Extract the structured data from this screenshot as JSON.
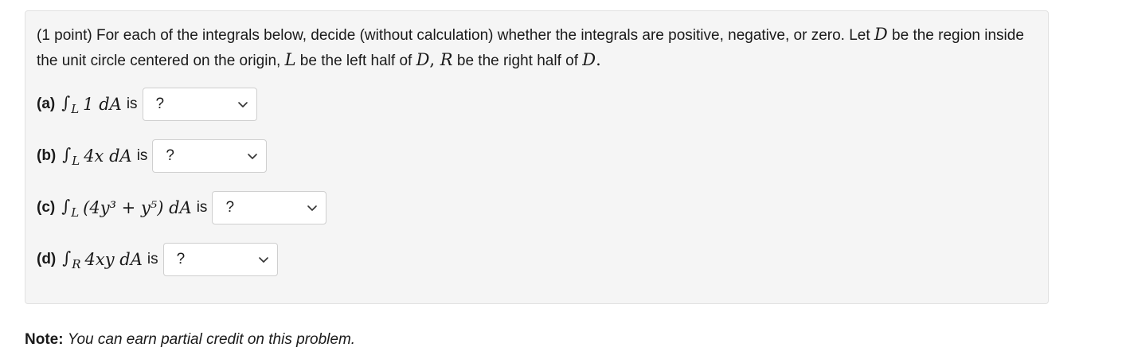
{
  "intro": {
    "prefix": "(1 point) For each of the integrals below, decide (without calculation) whether the integrals are positive, negative, or zero. Let ",
    "D": "D",
    "mid1": " be the region inside the unit circle centered on the origin, ",
    "L": "L",
    "mid2": " be the left half of ",
    "D2": "D",
    "comma": ", ",
    "R": "R",
    "mid3": " be the right half of ",
    "D3": "D",
    "end": "."
  },
  "parts": [
    {
      "label": "(a)",
      "region": "L",
      "expr": "1 dA",
      "is": "is",
      "selected": "?"
    },
    {
      "label": "(b)",
      "region": "L",
      "expr": "4x dA",
      "is": "is",
      "selected": "?"
    },
    {
      "label": "(c)",
      "region": "L",
      "expr": "(4y³ + y⁵) dA",
      "is": "is",
      "selected": "?"
    },
    {
      "label": "(d)",
      "region": "R",
      "expr": "4xy dA",
      "is": "is",
      "selected": "?"
    }
  ],
  "note": {
    "label": "Note:",
    "text": "You can earn partial credit on this problem."
  },
  "icons": {
    "dropdown": "chevron-down-icon"
  }
}
